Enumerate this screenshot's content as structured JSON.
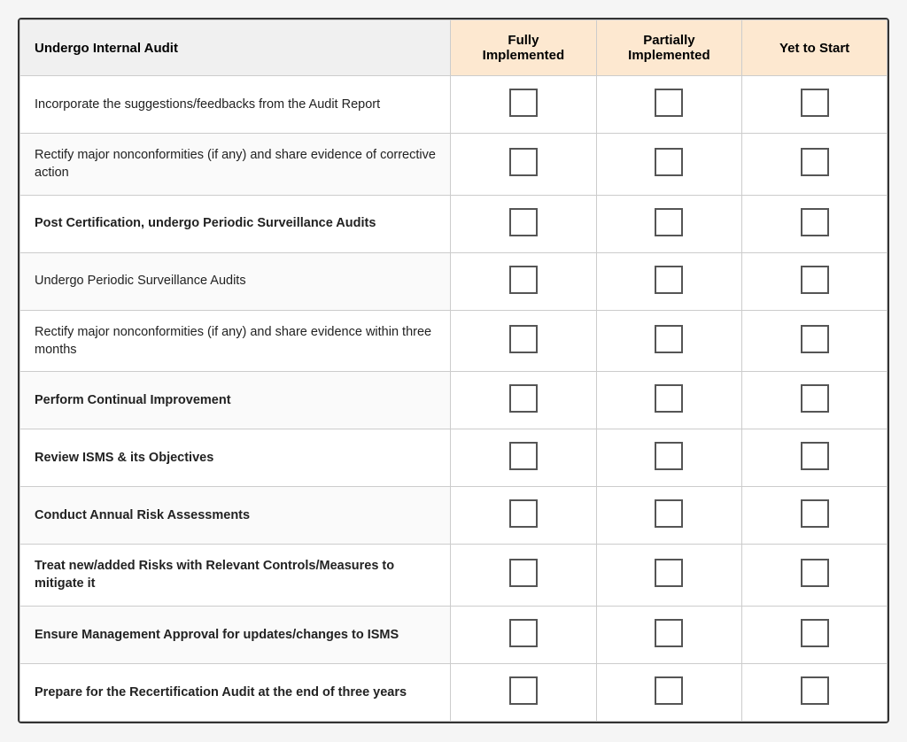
{
  "header": {
    "col1": "Undergo Internal Audit",
    "col2_line1": "Fully",
    "col2_line2": "Implemented",
    "col3_line1": "Partially",
    "col3_line2": "Implemented",
    "col4": "Yet to Start"
  },
  "rows": [
    {
      "label": "Incorporate the suggestions/feedbacks from the Audit Report",
      "bold": false
    },
    {
      "label": "Rectify major nonconformities (if any) and share evidence of corrective action",
      "bold": false
    },
    {
      "label": "Post Certification, undergo Periodic Surveillance Audits",
      "bold": true
    },
    {
      "label": "Undergo Periodic Surveillance Audits",
      "bold": false
    },
    {
      "label": "Rectify major nonconformities (if any) and share evidence within three months",
      "bold": false
    },
    {
      "label": "Perform Continual Improvement",
      "bold": true
    },
    {
      "label": "Review ISMS & its Objectives",
      "bold": true
    },
    {
      "label": "Conduct Annual Risk Assessments",
      "bold": true
    },
    {
      "label": "Treat new/added Risks with Relevant Controls/Measures to mitigate it",
      "bold": true
    },
    {
      "label": "Ensure Management Approval for updates/changes to ISMS",
      "bold": true
    },
    {
      "label": "Prepare for the Recertification Audit at the end of three years",
      "bold": true
    }
  ]
}
